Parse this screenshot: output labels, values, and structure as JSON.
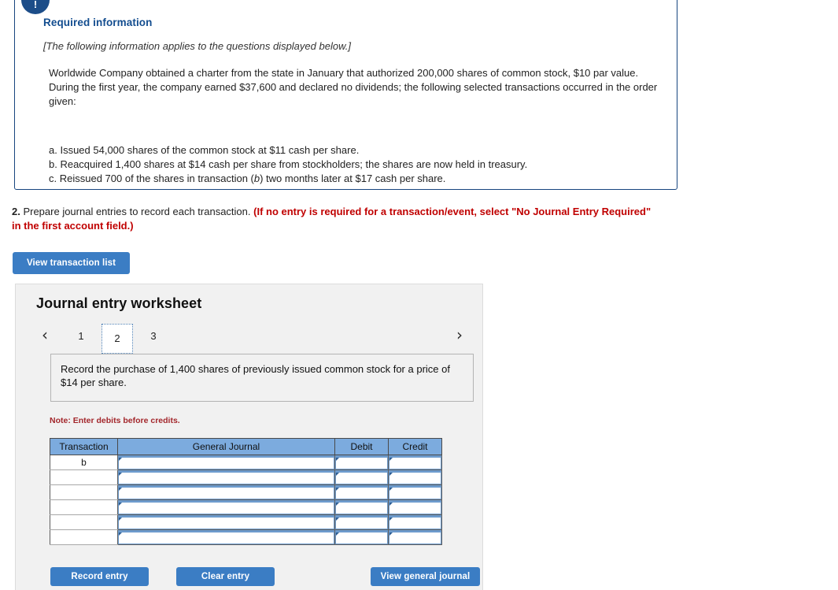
{
  "required_info": {
    "badge_icon": "exclamation-icon",
    "badge_glyph": "!",
    "title": "Required information",
    "applies_note": "[The following information applies to the questions displayed below.]",
    "body": "Worldwide Company obtained a charter from the state in January that authorized 200,000 shares of common stock, $10 par value. During the first year, the company earned $37,600 and declared no dividends; the following selected transactions occurred in the order given:",
    "transactions": [
      "a. Issued 54,000 shares of the common stock at $11 cash per share.",
      "b. Reacquired 1,400 shares at $14 cash per share from stockholders; the shares are now held in treasury.",
      "c. Reissued 700 of the shares in transaction (b) two months later at $17 cash per share."
    ],
    "transaction_c_parts": {
      "before": "c. Reissued 700 of the shares in transaction (",
      "italic": "b",
      "after": ") two months later at $17 cash per share."
    }
  },
  "question": {
    "number": "2.",
    "text": " Prepare journal entries to record each transaction. ",
    "emphasis": "(If no entry is required for a transaction/event, select \"No Journal Entry Required\" in the first account field.)",
    "emphasis_color": "#c00000"
  },
  "toolbar": {
    "view_transaction_list": "View transaction list"
  },
  "worksheet": {
    "title": "Journal entry worksheet",
    "pager": {
      "prev_icon": "chevron-left-icon",
      "prev_glyph": "‹",
      "next_icon": "chevron-right-icon",
      "next_glyph": "›",
      "pages": [
        "1",
        "2",
        "3"
      ],
      "active_page": "2"
    },
    "instruction": "Record the purchase of 1,400 shares of previously issued common stock for a price of $14 per share.",
    "note": "Note: Enter debits before credits.",
    "table": {
      "headers": [
        "Transaction",
        "General Journal",
        "Debit",
        "Credit"
      ],
      "rows": [
        {
          "transaction": "b",
          "general_journal": "",
          "debit": "",
          "credit": ""
        },
        {
          "transaction": "",
          "general_journal": "",
          "debit": "",
          "credit": ""
        },
        {
          "transaction": "",
          "general_journal": "",
          "debit": "",
          "credit": ""
        },
        {
          "transaction": "",
          "general_journal": "",
          "debit": "",
          "credit": ""
        },
        {
          "transaction": "",
          "general_journal": "",
          "debit": "",
          "credit": ""
        },
        {
          "transaction": "",
          "general_journal": "",
          "debit": "",
          "credit": ""
        }
      ]
    },
    "buttons": {
      "record_entry": "Record entry",
      "clear_entry": "Clear entry",
      "view_general_journal": "View general journal"
    }
  },
  "colors": {
    "accent_blue": "#3b7dc4",
    "panel_border_blue": "#17457f",
    "badge_blue": "#1c4d89",
    "table_header_blue": "#7cabde",
    "note_red": "#a3272c",
    "emphasis_red": "#c00000",
    "panel_gray": "#f1f1f1"
  }
}
